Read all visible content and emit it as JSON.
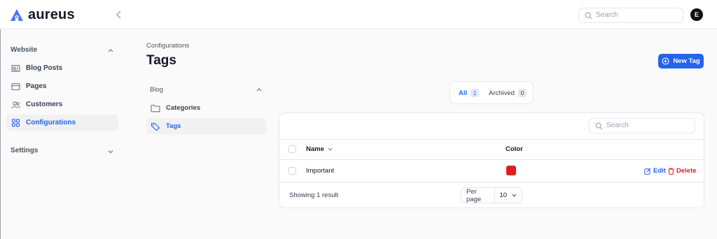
{
  "app": {
    "name": "aureus"
  },
  "topbar": {
    "search_placeholder": "Search",
    "avatar_initial": "E"
  },
  "sidebar": {
    "groups": [
      {
        "label": "Website",
        "items": [
          {
            "label": "Blog Posts"
          },
          {
            "label": "Pages"
          },
          {
            "label": "Customers"
          },
          {
            "label": "Configurations"
          }
        ]
      },
      {
        "label": "Settings",
        "items": []
      }
    ]
  },
  "page": {
    "breadcrumb": "Configurations",
    "title": "Tags",
    "new_button": "New Tag"
  },
  "subnav": {
    "group": "Blog",
    "items": [
      {
        "label": "Categories"
      },
      {
        "label": "Tags"
      }
    ]
  },
  "filters": {
    "tabs": [
      {
        "label": "All",
        "count": "1"
      },
      {
        "label": "Archived",
        "count": "0"
      }
    ]
  },
  "table": {
    "search_placeholder": "Search",
    "columns": [
      "Name",
      "Color"
    ],
    "rows": [
      {
        "name": "Important",
        "color": "#e11d1d"
      }
    ],
    "actions": {
      "edit": "Edit",
      "delete": "Delete"
    },
    "footer": {
      "summary": "Showing 1 result",
      "per_page_label": "Per page",
      "per_page_value": "10"
    }
  },
  "colors": {
    "accent": "#2563eb",
    "danger": "#dc2626"
  }
}
